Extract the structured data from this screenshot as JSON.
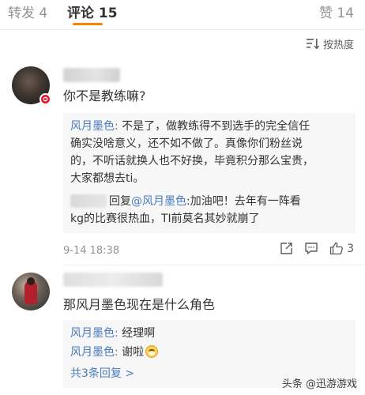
{
  "tabs": {
    "reposts": "转发 4",
    "comments": "评论 15",
    "likes": "赞 14"
  },
  "sort": {
    "label": "按热度",
    "icon": "sort-icon"
  },
  "comments": [
    {
      "text": "你不是教练嘛?",
      "badge": "weibo-badge-icon",
      "replies": [
        {
          "handle": "风月墨色:",
          "lines": [
            " 不是了，做教练得不到选手的完全信任",
            "确实没啥意义，还不如不做了。真像你们粉丝说",
            "的，不听话就换人也不好换，毕竟积分那么宝贵，",
            "大家都想去ti。"
          ]
        },
        {
          "prefix": "回复",
          "handle": "@风月墨色",
          "lines": [
            ":加油吧！去年有一阵看",
            "kg的比赛很热血，TI前莫名其妙就崩了"
          ]
        }
      ],
      "time": "9-14 18:38",
      "likes": "3"
    },
    {
      "text": "那风月墨色现在是什么角色",
      "replies": [
        {
          "handle": "风月墨色:",
          "text": " 经理啊"
        },
        {
          "handle": "风月墨色:",
          "text": " 谢啦"
        }
      ],
      "more": "共3条回复 >"
    }
  ],
  "watermark": "头条 @迅游游戏",
  "colors": {
    "accent": "#ff8200",
    "link": "#4a7cbe",
    "badge": "#e6162d"
  }
}
